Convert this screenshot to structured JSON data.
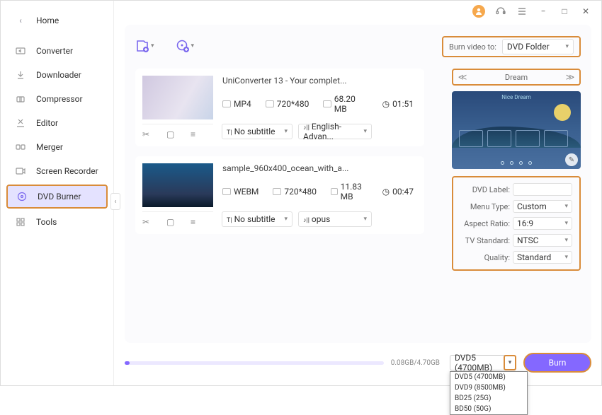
{
  "titlebar": {
    "min": "−",
    "max": "□",
    "close": "✕"
  },
  "sidebar": {
    "home": "Home",
    "items": [
      {
        "label": "Converter"
      },
      {
        "label": "Downloader"
      },
      {
        "label": "Compressor"
      },
      {
        "label": "Editor"
      },
      {
        "label": "Merger"
      },
      {
        "label": "Screen Recorder"
      },
      {
        "label": "DVD Burner"
      },
      {
        "label": "Tools"
      }
    ]
  },
  "burn_to": {
    "label": "Burn video to:",
    "value": "DVD Folder"
  },
  "files": [
    {
      "title": "UniConverter 13 - Your complet...",
      "format": "MP4",
      "res": "720*480",
      "size": "68.20 MB",
      "dur": "01:51",
      "sub": "No subtitle",
      "aud": "English-Advan..."
    },
    {
      "title": "sample_960x400_ocean_with_a...",
      "format": "WEBM",
      "res": "720*480",
      "size": "11.83 MB",
      "dur": "00:47",
      "sub": "No subtitle",
      "aud": "opus"
    }
  ],
  "preview": {
    "title": "Dream",
    "bar": "Nice Dream",
    "edit": "✎"
  },
  "opts": {
    "dvd_label": "DVD Label:",
    "menu_type": {
      "label": "Menu Type:",
      "value": "Custom"
    },
    "aspect": {
      "label": "Aspect Ratio:",
      "value": "16:9"
    },
    "tv": {
      "label": "TV Standard:",
      "value": "NTSC"
    },
    "quality": {
      "label": "Quality:",
      "value": "Standard"
    }
  },
  "footer": {
    "progress": "0.08GB/4.70GB",
    "disc": "DVD5 (4700MB)",
    "menu": [
      "DVD5 (4700MB)",
      "DVD9 (8500MB)",
      "BD25 (25G)",
      "BD50 (50G)"
    ],
    "burn": "Burn"
  }
}
